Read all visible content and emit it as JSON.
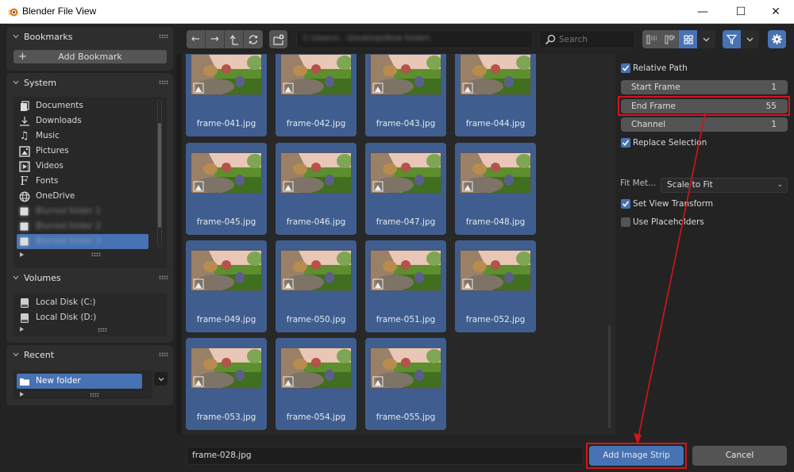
{
  "window": {
    "title": "Blender File View",
    "minimize_label": "—",
    "maximize_label": "☐",
    "close_label": "✕"
  },
  "sidebar": {
    "bookmarks": {
      "title": "Bookmarks",
      "add_label": "Add Bookmark"
    },
    "system": {
      "title": "System",
      "items": [
        {
          "label": "Documents",
          "icon": "documents-icon"
        },
        {
          "label": "Downloads",
          "icon": "downloads-icon"
        },
        {
          "label": "Music",
          "icon": "music-icon"
        },
        {
          "label": "Pictures",
          "icon": "pictures-icon"
        },
        {
          "label": "Videos",
          "icon": "videos-icon"
        },
        {
          "label": "Fonts",
          "icon": "fonts-icon"
        },
        {
          "label": "OneDrive",
          "icon": "globe-icon"
        },
        {
          "label": "Blurred folder 1",
          "icon": "folder-icon",
          "blurred": true
        },
        {
          "label": "Blurred folder 2",
          "icon": "folder-icon",
          "blurred": true
        },
        {
          "label": "Blurred folder 3",
          "icon": "folder-icon",
          "blurred": true,
          "selected": true
        }
      ]
    },
    "volumes": {
      "title": "Volumes",
      "items": [
        {
          "label": "Local Disk (C:)",
          "icon": "disk-icon"
        },
        {
          "label": "Local Disk (D:)",
          "icon": "disk-icon"
        }
      ]
    },
    "recent": {
      "title": "Recent",
      "items": [
        {
          "label": "New folder",
          "icon": "folder-icon",
          "selected": true
        }
      ]
    }
  },
  "toolbar": {
    "back_glyph": "←",
    "forward_glyph": "→",
    "parent_glyph": "⮤",
    "refresh_glyph": "⟳",
    "path_value": "C:\\Users\\...\\Desktop\\New folder\\",
    "search_placeholder": "Search",
    "display_mode": "thumbnails",
    "filter_enabled": true
  },
  "files": [
    "frame-041.jpg",
    "frame-042.jpg",
    "frame-043.jpg",
    "frame-044.jpg",
    "frame-045.jpg",
    "frame-046.jpg",
    "frame-047.jpg",
    "frame-048.jpg",
    "frame-049.jpg",
    "frame-050.jpg",
    "frame-051.jpg",
    "frame-052.jpg",
    "frame-053.jpg",
    "frame-054.jpg",
    "frame-055.jpg"
  ],
  "properties": {
    "relative_path": {
      "label": "Relative Path",
      "checked": true
    },
    "start_frame": {
      "label": "Start Frame",
      "value": "1"
    },
    "end_frame": {
      "label": "End Frame",
      "value": "55"
    },
    "channel": {
      "label": "Channel",
      "value": "1"
    },
    "replace_selection": {
      "label": "Replace Selection",
      "checked": true
    },
    "fit_method": {
      "label": "Fit Met...",
      "value": "Scale to Fit"
    },
    "set_view_transform": {
      "label": "Set View Transform",
      "checked": true
    },
    "use_placeholders": {
      "label": "Use Placeholders",
      "checked": false
    }
  },
  "bottom": {
    "filename_value": "frame-028.jpg",
    "confirm_label": "Add Image Strip",
    "cancel_label": "Cancel"
  },
  "colors": {
    "accent": "#4772b3",
    "annotation": "#d6141c",
    "tile": "#3f5e8f"
  }
}
